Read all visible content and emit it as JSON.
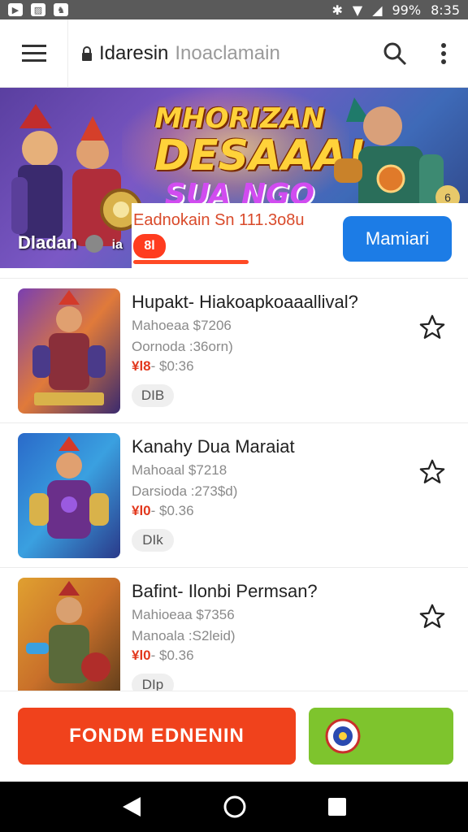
{
  "status_bar": {
    "battery": "99%",
    "time": "8:35"
  },
  "browser": {
    "url_domain": "Idaresin",
    "url_path": "Inoaclamain"
  },
  "banner": {
    "title_line1": "MHORIZAN",
    "title_line2": "DESAAA!",
    "title_line3": "SUA NGO",
    "side_label": "Dladan",
    "side_label_tail": "ia",
    "badge": "6"
  },
  "promo": {
    "text": "Eadnokain Sn 111.3o8u",
    "pill": "8l",
    "button": "Mamiari"
  },
  "items": [
    {
      "title": "Hupakt- Hiakoapkoaaallival?",
      "line1": "Mahoeaa $7206",
      "line2": "Oornoda :36orn)",
      "price_hot": "¥l8",
      "price_rest": "- $0:36",
      "tag": "DIB"
    },
    {
      "title": "Kanahy Dua Maraiat",
      "line1": "Mahoaal $7218",
      "line2": "Darsioda :273$d)",
      "price_hot": "¥l0",
      "price_rest": "- $0.36",
      "tag": "DIk"
    },
    {
      "title": "Bafint- Ilonbi Permsan?",
      "line1": "Mahioeaa $7356",
      "line2": "Manoala :S2leid)",
      "price_hot": "¥l0",
      "price_rest": "- $0.36",
      "tag": "DIp"
    }
  ],
  "bottom": {
    "cta": "FONDM EDNENIN"
  },
  "colors": {
    "accent_red": "#f0421c",
    "accent_blue": "#1c7ce6",
    "accent_green": "#7ec42d"
  }
}
